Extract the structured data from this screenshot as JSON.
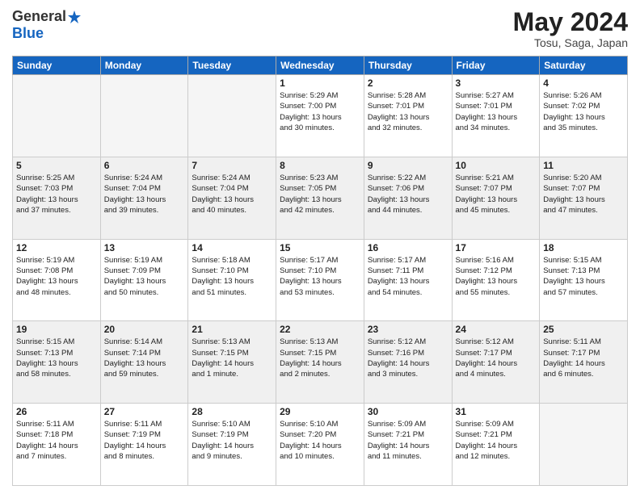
{
  "logo": {
    "general": "General",
    "blue": "Blue"
  },
  "header": {
    "month": "May 2024",
    "location": "Tosu, Saga, Japan"
  },
  "weekdays": [
    "Sunday",
    "Monday",
    "Tuesday",
    "Wednesday",
    "Thursday",
    "Friday",
    "Saturday"
  ],
  "weeks": [
    [
      {
        "day": "",
        "info": ""
      },
      {
        "day": "",
        "info": ""
      },
      {
        "day": "",
        "info": ""
      },
      {
        "day": "1",
        "info": "Sunrise: 5:29 AM\nSunset: 7:00 PM\nDaylight: 13 hours\nand 30 minutes."
      },
      {
        "day": "2",
        "info": "Sunrise: 5:28 AM\nSunset: 7:01 PM\nDaylight: 13 hours\nand 32 minutes."
      },
      {
        "day": "3",
        "info": "Sunrise: 5:27 AM\nSunset: 7:01 PM\nDaylight: 13 hours\nand 34 minutes."
      },
      {
        "day": "4",
        "info": "Sunrise: 5:26 AM\nSunset: 7:02 PM\nDaylight: 13 hours\nand 35 minutes."
      }
    ],
    [
      {
        "day": "5",
        "info": "Sunrise: 5:25 AM\nSunset: 7:03 PM\nDaylight: 13 hours\nand 37 minutes."
      },
      {
        "day": "6",
        "info": "Sunrise: 5:24 AM\nSunset: 7:04 PM\nDaylight: 13 hours\nand 39 minutes."
      },
      {
        "day": "7",
        "info": "Sunrise: 5:24 AM\nSunset: 7:04 PM\nDaylight: 13 hours\nand 40 minutes."
      },
      {
        "day": "8",
        "info": "Sunrise: 5:23 AM\nSunset: 7:05 PM\nDaylight: 13 hours\nand 42 minutes."
      },
      {
        "day": "9",
        "info": "Sunrise: 5:22 AM\nSunset: 7:06 PM\nDaylight: 13 hours\nand 44 minutes."
      },
      {
        "day": "10",
        "info": "Sunrise: 5:21 AM\nSunset: 7:07 PM\nDaylight: 13 hours\nand 45 minutes."
      },
      {
        "day": "11",
        "info": "Sunrise: 5:20 AM\nSunset: 7:07 PM\nDaylight: 13 hours\nand 47 minutes."
      }
    ],
    [
      {
        "day": "12",
        "info": "Sunrise: 5:19 AM\nSunset: 7:08 PM\nDaylight: 13 hours\nand 48 minutes."
      },
      {
        "day": "13",
        "info": "Sunrise: 5:19 AM\nSunset: 7:09 PM\nDaylight: 13 hours\nand 50 minutes."
      },
      {
        "day": "14",
        "info": "Sunrise: 5:18 AM\nSunset: 7:10 PM\nDaylight: 13 hours\nand 51 minutes."
      },
      {
        "day": "15",
        "info": "Sunrise: 5:17 AM\nSunset: 7:10 PM\nDaylight: 13 hours\nand 53 minutes."
      },
      {
        "day": "16",
        "info": "Sunrise: 5:17 AM\nSunset: 7:11 PM\nDaylight: 13 hours\nand 54 minutes."
      },
      {
        "day": "17",
        "info": "Sunrise: 5:16 AM\nSunset: 7:12 PM\nDaylight: 13 hours\nand 55 minutes."
      },
      {
        "day": "18",
        "info": "Sunrise: 5:15 AM\nSunset: 7:13 PM\nDaylight: 13 hours\nand 57 minutes."
      }
    ],
    [
      {
        "day": "19",
        "info": "Sunrise: 5:15 AM\nSunset: 7:13 PM\nDaylight: 13 hours\nand 58 minutes."
      },
      {
        "day": "20",
        "info": "Sunrise: 5:14 AM\nSunset: 7:14 PM\nDaylight: 13 hours\nand 59 minutes."
      },
      {
        "day": "21",
        "info": "Sunrise: 5:13 AM\nSunset: 7:15 PM\nDaylight: 14 hours\nand 1 minute."
      },
      {
        "day": "22",
        "info": "Sunrise: 5:13 AM\nSunset: 7:15 PM\nDaylight: 14 hours\nand 2 minutes."
      },
      {
        "day": "23",
        "info": "Sunrise: 5:12 AM\nSunset: 7:16 PM\nDaylight: 14 hours\nand 3 minutes."
      },
      {
        "day": "24",
        "info": "Sunrise: 5:12 AM\nSunset: 7:17 PM\nDaylight: 14 hours\nand 4 minutes."
      },
      {
        "day": "25",
        "info": "Sunrise: 5:11 AM\nSunset: 7:17 PM\nDaylight: 14 hours\nand 6 minutes."
      }
    ],
    [
      {
        "day": "26",
        "info": "Sunrise: 5:11 AM\nSunset: 7:18 PM\nDaylight: 14 hours\nand 7 minutes."
      },
      {
        "day": "27",
        "info": "Sunrise: 5:11 AM\nSunset: 7:19 PM\nDaylight: 14 hours\nand 8 minutes."
      },
      {
        "day": "28",
        "info": "Sunrise: 5:10 AM\nSunset: 7:19 PM\nDaylight: 14 hours\nand 9 minutes."
      },
      {
        "day": "29",
        "info": "Sunrise: 5:10 AM\nSunset: 7:20 PM\nDaylight: 14 hours\nand 10 minutes."
      },
      {
        "day": "30",
        "info": "Sunrise: 5:09 AM\nSunset: 7:21 PM\nDaylight: 14 hours\nand 11 minutes."
      },
      {
        "day": "31",
        "info": "Sunrise: 5:09 AM\nSunset: 7:21 PM\nDaylight: 14 hours\nand 12 minutes."
      },
      {
        "day": "",
        "info": ""
      }
    ]
  ]
}
